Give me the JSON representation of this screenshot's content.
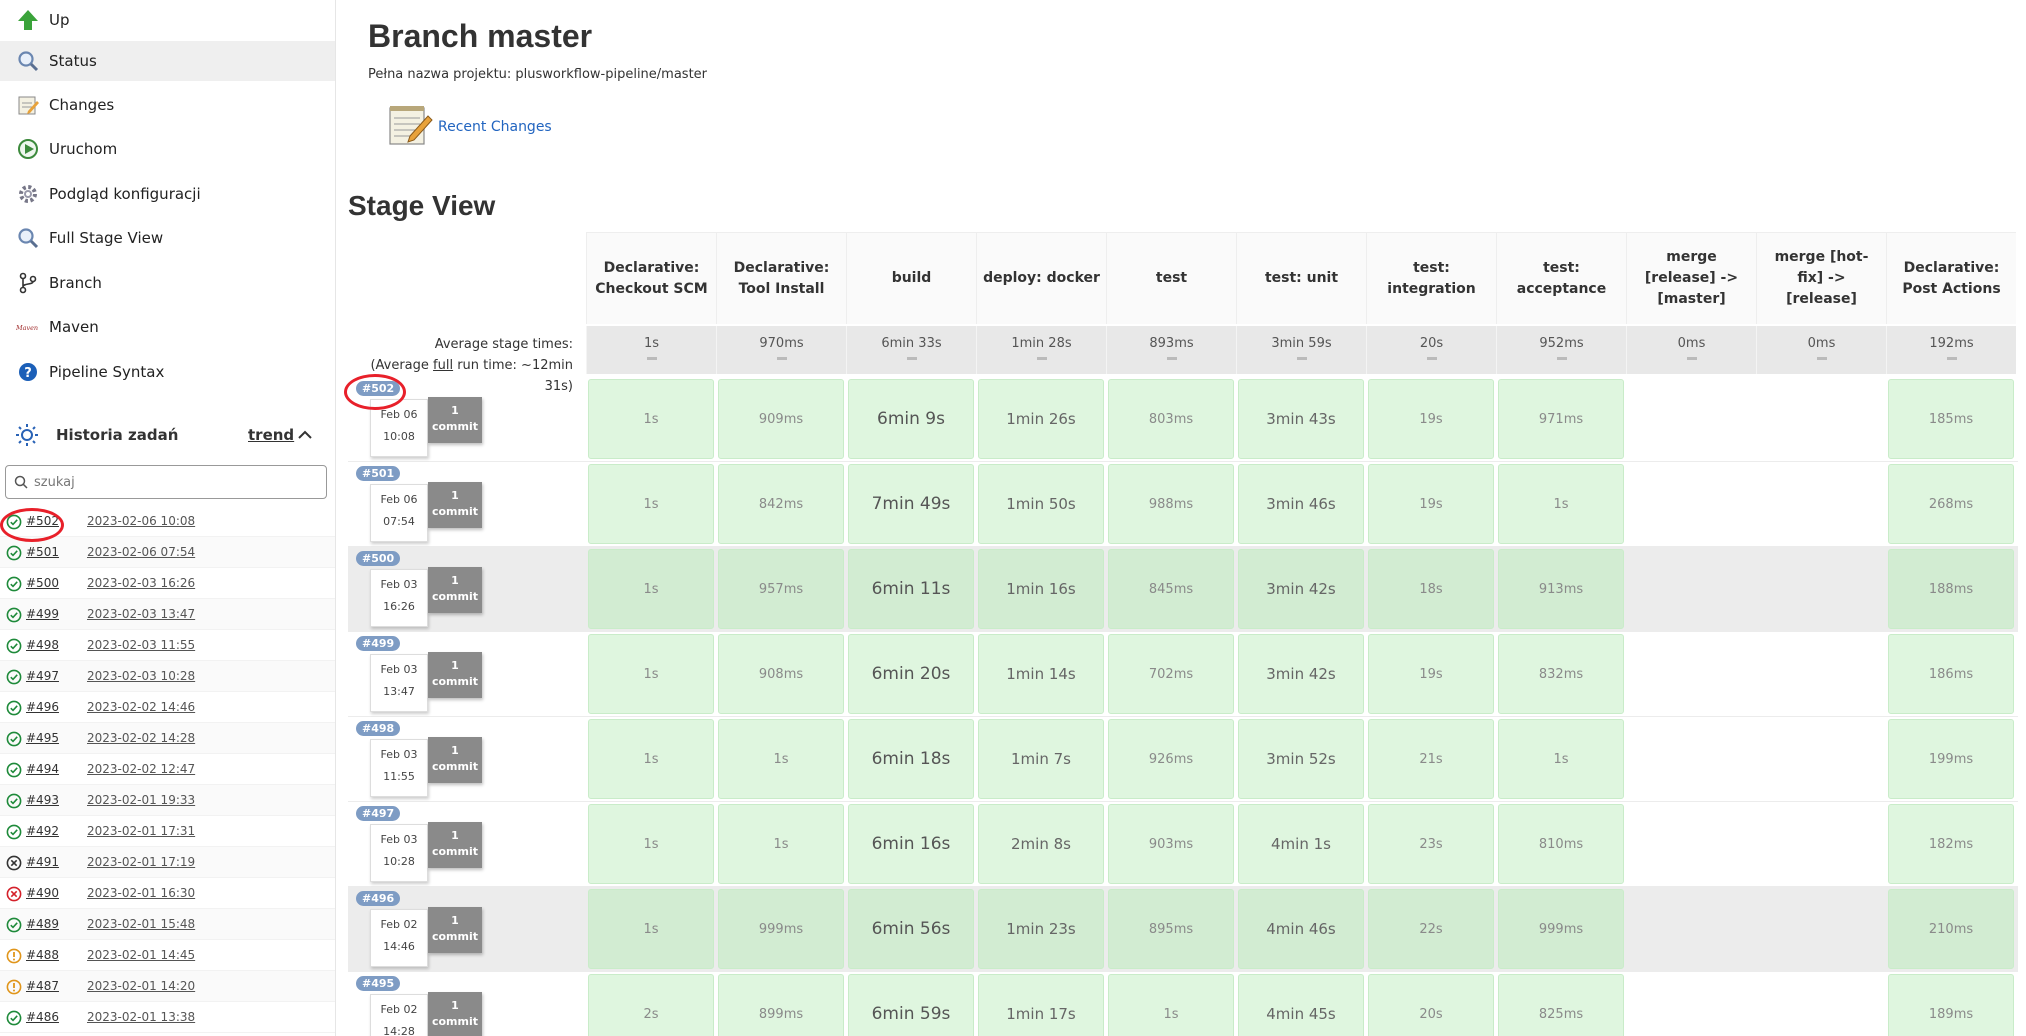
{
  "sidebar": {
    "tasks": [
      {
        "label": "Up",
        "icon": "up-arrow-icon",
        "active": false
      },
      {
        "label": "Status",
        "icon": "search-icon",
        "active": true
      },
      {
        "label": "Changes",
        "icon": "notepad-icon",
        "active": false
      },
      {
        "label": "Uruchom",
        "icon": "clock-play-icon",
        "active": false
      },
      {
        "label": "Podgląd konfiguracji",
        "icon": "gear-icon",
        "active": false
      },
      {
        "label": "Full Stage View",
        "icon": "search-icon",
        "active": false
      },
      {
        "label": "Branch",
        "icon": "branch-icon",
        "active": false
      },
      {
        "label": "Maven",
        "icon": "maven-logo-icon",
        "active": false
      },
      {
        "label": "Pipeline Syntax",
        "icon": "help-icon",
        "active": false
      }
    ],
    "history": {
      "title": "Historia zadań",
      "trend_label": "trend",
      "search_placeholder": "szukaj",
      "builds": [
        {
          "number": "#502",
          "date": "2023-02-06 10:08",
          "status": "success"
        },
        {
          "number": "#501",
          "date": "2023-02-06 07:54",
          "status": "success"
        },
        {
          "number": "#500",
          "date": "2023-02-03 16:26",
          "status": "success"
        },
        {
          "number": "#499",
          "date": "2023-02-03 13:47",
          "status": "success"
        },
        {
          "number": "#498",
          "date": "2023-02-03 11:55",
          "status": "success"
        },
        {
          "number": "#497",
          "date": "2023-02-03 10:28",
          "status": "success"
        },
        {
          "number": "#496",
          "date": "2023-02-02 14:46",
          "status": "success"
        },
        {
          "number": "#495",
          "date": "2023-02-02 14:28",
          "status": "success"
        },
        {
          "number": "#494",
          "date": "2023-02-02 12:47",
          "status": "success"
        },
        {
          "number": "#493",
          "date": "2023-02-01 19:33",
          "status": "success"
        },
        {
          "number": "#492",
          "date": "2023-02-01 17:31",
          "status": "success"
        },
        {
          "number": "#491",
          "date": "2023-02-01 17:19",
          "status": "aborted"
        },
        {
          "number": "#490",
          "date": "2023-02-01 16:30",
          "status": "failed"
        },
        {
          "number": "#489",
          "date": "2023-02-01 15:48",
          "status": "success"
        },
        {
          "number": "#488",
          "date": "2023-02-01 14:45",
          "status": "unstable"
        },
        {
          "number": "#487",
          "date": "2023-02-01 14:20",
          "status": "unstable"
        },
        {
          "number": "#486",
          "date": "2023-02-01 13:38",
          "status": "success"
        }
      ]
    }
  },
  "main": {
    "title": "Branch master",
    "full_name": "Pełna nazwa projektu: plusworkflow-pipeline/master",
    "recent_changes": "Recent Changes",
    "stage_view_title": "Stage View",
    "avg_label_1": "Average stage times:",
    "avg_label_2a": "(Average ",
    "avg_label_2u": "full",
    "avg_label_2b": " run time: ~12min",
    "avg_label_3": "31s)",
    "stages": [
      {
        "name": "Declarative: Checkout SCM",
        "avg": "1s"
      },
      {
        "name": "Declarative: Tool Install",
        "avg": "970ms"
      },
      {
        "name": "build",
        "avg": "6min 33s"
      },
      {
        "name": "deploy: docker",
        "avg": "1min 28s"
      },
      {
        "name": "test",
        "avg": "893ms"
      },
      {
        "name": "test: unit",
        "avg": "3min 59s"
      },
      {
        "name": "test: integration",
        "avg": "20s"
      },
      {
        "name": "test: acceptance",
        "avg": "952ms"
      },
      {
        "name": "merge [release] -> [master]",
        "avg": "0ms"
      },
      {
        "name": "merge [hot-fix] -> [release]",
        "avg": "0ms"
      },
      {
        "name": "Declarative: Post Actions",
        "avg": "192ms"
      }
    ],
    "runs": [
      {
        "badge": "#502",
        "day": "Feb 06",
        "time": "10:08",
        "commits": "1",
        "commit_word": "commit",
        "shaded": false,
        "cells": [
          "1s",
          "909ms",
          "6min 9s",
          "1min 26s",
          "803ms",
          "3min 43s",
          "19s",
          "971ms",
          "",
          "",
          "185ms"
        ]
      },
      {
        "badge": "#501",
        "day": "Feb 06",
        "time": "07:54",
        "commits": "1",
        "commit_word": "commit",
        "shaded": false,
        "cells": [
          "1s",
          "842ms",
          "7min 49s",
          "1min 50s",
          "988ms",
          "3min 46s",
          "19s",
          "1s",
          "",
          "",
          "268ms"
        ]
      },
      {
        "badge": "#500",
        "day": "Feb 03",
        "time": "16:26",
        "commits": "1",
        "commit_word": "commit",
        "shaded": true,
        "cells": [
          "1s",
          "957ms",
          "6min 11s",
          "1min 16s",
          "845ms",
          "3min 42s",
          "18s",
          "913ms",
          "",
          "",
          "188ms"
        ]
      },
      {
        "badge": "#499",
        "day": "Feb 03",
        "time": "13:47",
        "commits": "1",
        "commit_word": "commit",
        "shaded": false,
        "cells": [
          "1s",
          "908ms",
          "6min 20s",
          "1min 14s",
          "702ms",
          "3min 42s",
          "19s",
          "832ms",
          "",
          "",
          "186ms"
        ]
      },
      {
        "badge": "#498",
        "day": "Feb 03",
        "time": "11:55",
        "commits": "1",
        "commit_word": "commit",
        "shaded": false,
        "cells": [
          "1s",
          "1s",
          "6min 18s",
          "1min 7s",
          "926ms",
          "3min 52s",
          "21s",
          "1s",
          "",
          "",
          "199ms"
        ]
      },
      {
        "badge": "#497",
        "day": "Feb 03",
        "time": "10:28",
        "commits": "1",
        "commit_word": "commit",
        "shaded": false,
        "cells": [
          "1s",
          "1s",
          "6min 16s",
          "2min 8s",
          "903ms",
          "4min 1s",
          "23s",
          "810ms",
          "",
          "",
          "182ms"
        ]
      },
      {
        "badge": "#496",
        "day": "Feb 02",
        "time": "14:46",
        "commits": "1",
        "commit_word": "commit",
        "shaded": true,
        "cells": [
          "1s",
          "999ms",
          "6min 56s",
          "1min 23s",
          "895ms",
          "4min 46s",
          "22s",
          "999ms",
          "",
          "",
          "210ms"
        ]
      },
      {
        "badge": "#495",
        "day": "Feb 02",
        "time": "14:28",
        "commits": "1",
        "commit_word": "commit",
        "shaded": false,
        "cells": [
          "2s",
          "899ms",
          "6min 59s",
          "1min 17s",
          "1s",
          "4min 45s",
          "20s",
          "825ms",
          "",
          "",
          "189ms"
        ]
      }
    ]
  },
  "colors": {
    "stage_success": "#dff6df",
    "badge": "#7e9cc4",
    "link": "#2265c0",
    "highlight_ellipse": "#e8202a"
  }
}
